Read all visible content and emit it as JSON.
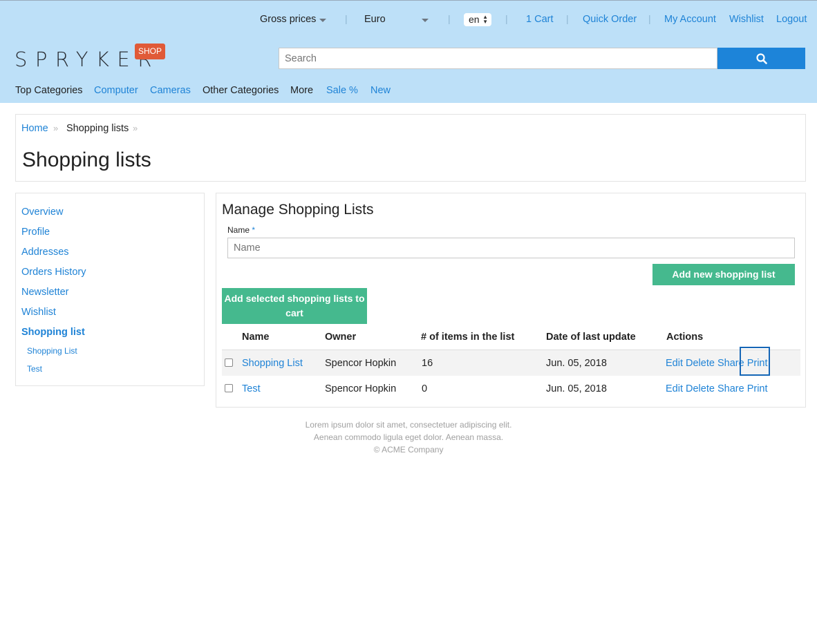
{
  "topbar": {
    "price_mode": "Gross prices",
    "currency": "Euro",
    "language": "en",
    "cart": "1 Cart",
    "quick_order": "Quick Order",
    "my_account": "My Account",
    "wishlist": "Wishlist",
    "logout": "Logout"
  },
  "brand": {
    "logo_text": "SPRYKER",
    "badge": "SHOP"
  },
  "search": {
    "placeholder": "Search",
    "button_icon": "search-icon"
  },
  "nav": {
    "items": [
      "Top Categories",
      "Computer",
      "Cameras",
      "Other Categories",
      "More",
      "Sale %",
      "New"
    ]
  },
  "breadcrumb": {
    "home": "Home",
    "current": "Shopping lists",
    "separator": "»"
  },
  "page_title": "Shopping lists",
  "sidebar": {
    "items": [
      "Overview",
      "Profile",
      "Addresses",
      "Orders History",
      "Newsletter",
      "Wishlist",
      "Shopping list"
    ],
    "sub_items": [
      "Shopping List",
      "Test"
    ]
  },
  "main": {
    "title": "Manage Shopping Lists",
    "name_label": "Name",
    "required_mark": "*",
    "name_placeholder": "Name",
    "add_button": "Add new shopping list",
    "add_to_cart_button": "Add selected shopping lists to cart",
    "columns": [
      "Name",
      "Owner",
      "# of items in the list",
      "Date of last update",
      "Actions"
    ],
    "rows": [
      {
        "name": "Shopping List",
        "owner": "Spencor Hopkin",
        "items": "16",
        "date": "Jun. 05, 2018",
        "checked": false
      },
      {
        "name": "Test",
        "owner": "Spencor Hopkin",
        "items": "0",
        "date": "Jun. 05, 2018",
        "checked": false
      }
    ],
    "actions": {
      "edit": "Edit",
      "delete": "Delete",
      "share": "Share",
      "print": "Print"
    }
  },
  "footer": {
    "line1": "Lorem ipsum dolor sit amet, consectetuer adipiscing elit.",
    "line2": "Aenean commodo ligula eget dolor. Aenean massa.",
    "line3": "© ACME Company"
  },
  "colors": {
    "header_bg": "#bde0f8",
    "link": "#1f83d6",
    "primary_button": "#1d84d9",
    "green_button": "#45b98e",
    "badge": "#e05a38",
    "highlight_border": "#1566b6"
  }
}
